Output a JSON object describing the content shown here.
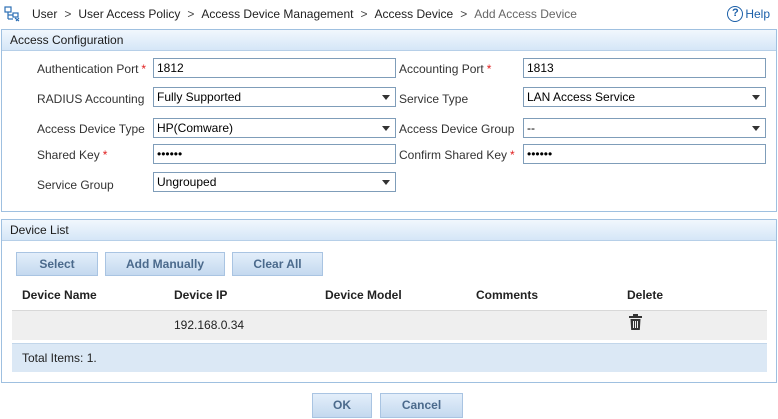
{
  "breadcrumb": {
    "items": [
      "User",
      "User Access Policy",
      "Access Device Management",
      "Access Device",
      "Add Access Device"
    ],
    "separator": ">"
  },
  "help": {
    "label": "Help"
  },
  "access_config": {
    "title": "Access Configuration",
    "auth_port": {
      "label": "Authentication Port",
      "value": "1812"
    },
    "acct_port": {
      "label": "Accounting Port",
      "value": "1813"
    },
    "radius_accounting": {
      "label": "RADIUS Accounting",
      "value": "Fully Supported"
    },
    "service_type": {
      "label": "Service Type",
      "value": "LAN Access Service"
    },
    "device_type": {
      "label": "Access Device Type",
      "value": "HP(Comware)"
    },
    "device_group": {
      "label": "Access Device Group",
      "value": "--"
    },
    "shared_key": {
      "label": "Shared Key",
      "value": "••••••"
    },
    "confirm_key": {
      "label": "Confirm Shared Key",
      "value": "••••••"
    },
    "service_group": {
      "label": "Service Group",
      "value": "Ungrouped"
    },
    "required_mark": "*"
  },
  "device_list": {
    "title": "Device List",
    "buttons": {
      "select": "Select",
      "add_manually": "Add Manually",
      "clear_all": "Clear All"
    },
    "columns": [
      "Device Name",
      "Device IP",
      "Device Model",
      "Comments",
      "Delete"
    ],
    "rows": [
      {
        "device_name": "",
        "device_ip": "192.168.0.34",
        "device_model": "",
        "comments": ""
      }
    ],
    "total": "Total Items: 1."
  },
  "footer": {
    "ok": "OK",
    "cancel": "Cancel"
  },
  "colors": {
    "panel_border": "#9fc0e0",
    "header_bg": "#d5e6f7",
    "button_text": "#4b6a8c",
    "required": "#e02020",
    "help_link": "#1b5fa8"
  },
  "icons": {
    "breadcrumb": "config-tree-icon",
    "help": "help-circle-icon",
    "delete": "trash-icon",
    "dropdown": "chevron-down-icon"
  }
}
